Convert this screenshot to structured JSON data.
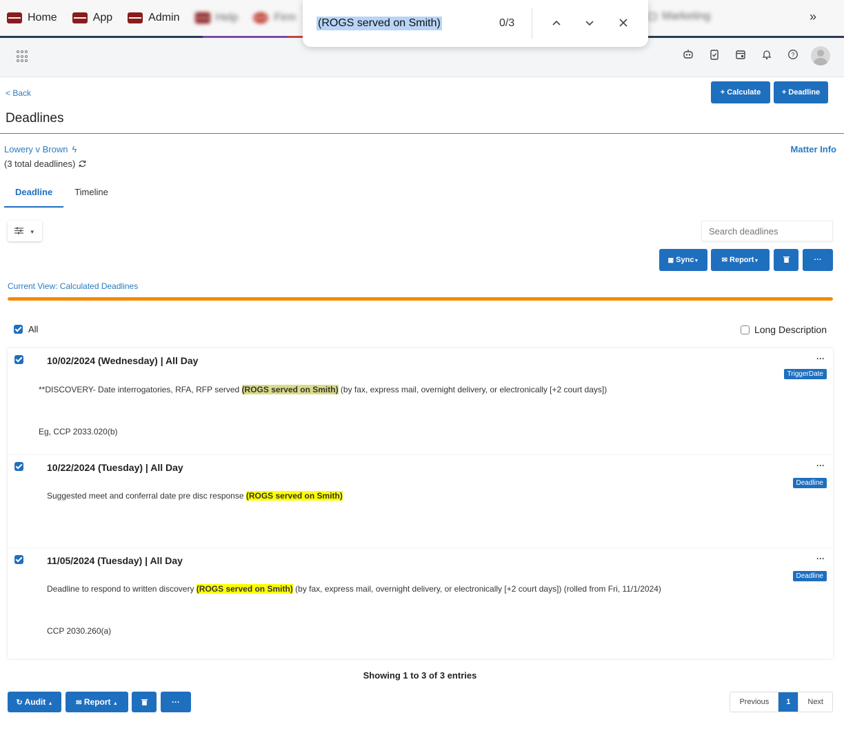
{
  "bookmarks": {
    "items": [
      {
        "label": "Home"
      },
      {
        "label": "App"
      },
      {
        "label": "Admin"
      },
      {
        "label": "Help"
      },
      {
        "label": "Firm"
      }
    ],
    "right_label": "Marketing",
    "overflow": "»"
  },
  "find": {
    "query": "(ROGS served on Smith)",
    "count": "0/3"
  },
  "page": {
    "back": "< Back",
    "title": "Deadlines",
    "calculate_btn": "+ Calculate",
    "deadline_btn": "+ Deadline"
  },
  "matter": {
    "name": "Lowery v Brown",
    "total": "(3 total deadlines)",
    "info_link": "Matter Info"
  },
  "tabs": [
    {
      "label": "Deadline"
    },
    {
      "label": "Timeline"
    }
  ],
  "toolbar": {
    "search_placeholder": "Search deadlines",
    "sync": "Sync",
    "report": "Report",
    "more": "···"
  },
  "view": {
    "label": "Current View: Calculated Deadlines",
    "progress": 1.0,
    "accent": "#f58a07"
  },
  "select_all": "All",
  "long_description": "Long Description",
  "deadlines": [
    {
      "date": "10/02/2024 (Wednesday)  |  All Day",
      "desc_before": "**DISCOVERY- Date interrogatories, RFA, RFP served ",
      "highlight": "(ROGS served on Smith)",
      "desc_after": " (by fax, express mail, overnight delivery, or electronically [+2 court days])",
      "cite": "Eg, CCP 2033.020(b)",
      "badge": "TriggerDate"
    },
    {
      "date": "10/22/2024 (Tuesday)  |  All Day",
      "desc_before": "Suggested meet and conferral date pre disc response ",
      "highlight": "(ROGS served on Smith)",
      "desc_after": "",
      "cite": "",
      "badge": "Deadline"
    },
    {
      "date": "11/05/2024 (Tuesday)  |  All Day",
      "desc_before": "Deadline to respond to written discovery ",
      "highlight": "(ROGS served on Smith)",
      "desc_after": " (by fax, express mail, overnight delivery, or electronically [+2 court days]) (rolled from Fri, 11/1/2024)",
      "cite": "CCP 2030.260(a)",
      "badge": "Deadline"
    }
  ],
  "more_dots": "···",
  "showing": "Showing 1 to 3 of 3 entries",
  "footer": {
    "audit": "Audit",
    "report": "Report",
    "more": "···"
  },
  "pager": {
    "previous": "Previous",
    "current": "1",
    "next": "Next"
  },
  "colors": {
    "primary": "#1f6fbf",
    "link": "#2a7ac0",
    "highlight": "#ffff00",
    "current_highlight": "#d8dc87",
    "danger_line": "#d9534f"
  }
}
